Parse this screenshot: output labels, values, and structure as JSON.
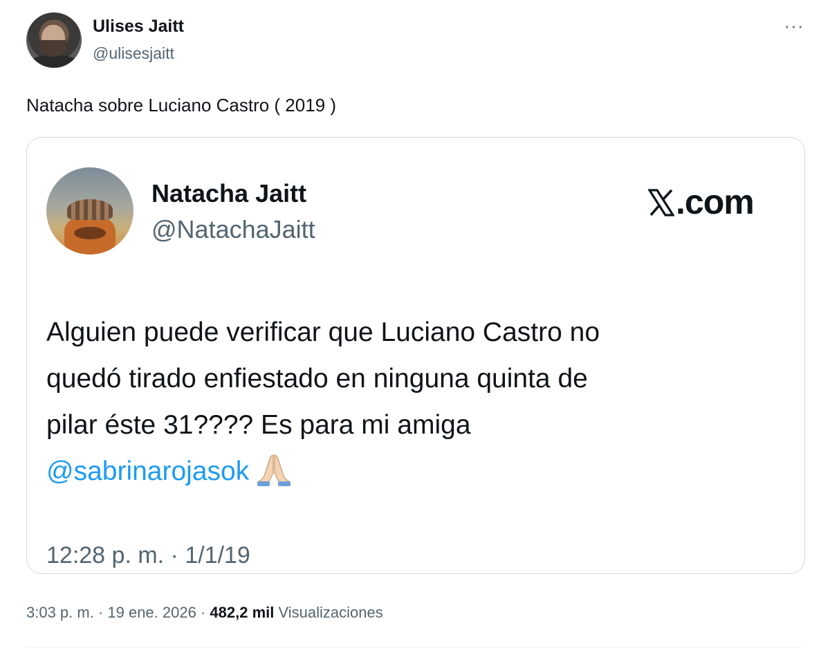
{
  "author": {
    "name": "Ulises Jaitt",
    "handle": "@ulisesjaitt"
  },
  "tweet": {
    "text": "Natacha sobre Luciano Castro ( 2019 )"
  },
  "quoted": {
    "name": "Natacha Jaitt",
    "handle": "@NatachaJaitt",
    "brand": ".com",
    "brand_icon": "x-logo-icon",
    "lines": [
      "Alguien puede verificar que Luciano Castro no",
      "quedó tirado enfiestado en ninguna quinta de",
      "pilar éste 31???? Es para mi amiga"
    ],
    "mention": "@sabrinarojasok",
    "emoji": "folded-hands-icon",
    "timestamp": "12:28 p. m. · 1/1/19"
  },
  "meta": {
    "time": "3:03 p. m. · 19 ene. 2026 ·",
    "views_count": "482,2 mil",
    "views_label": "Visualizaciones"
  },
  "colors": {
    "mention": "#1d9bf0",
    "secondary_text": "#536471",
    "primary_text": "#0f1419",
    "border": "#cfd9de"
  }
}
